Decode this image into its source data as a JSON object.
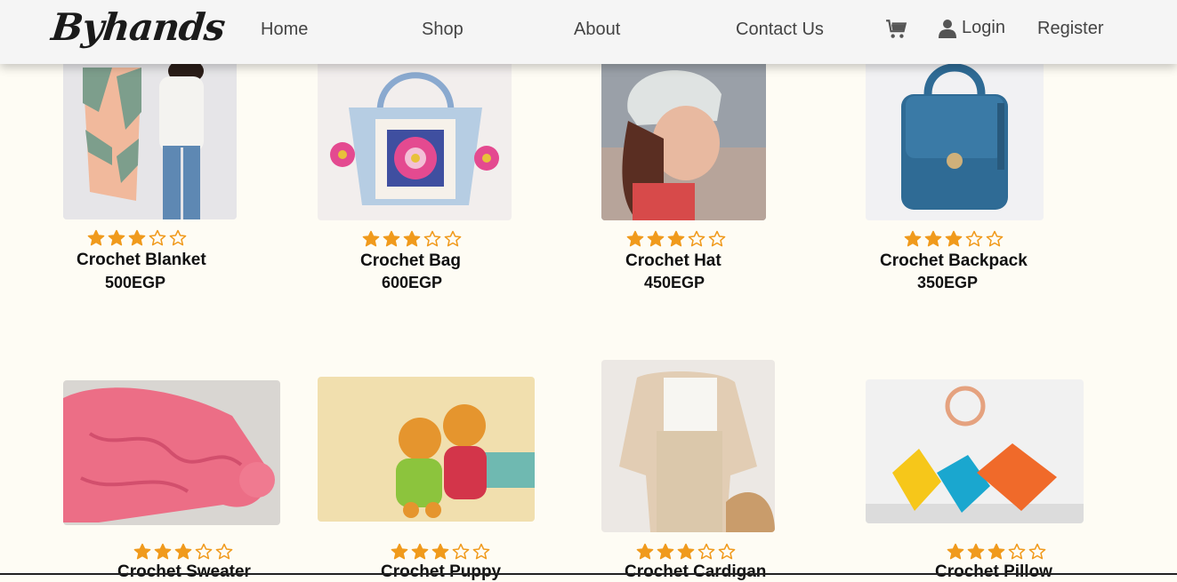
{
  "brand": {
    "logo_text": "Byhands"
  },
  "nav": {
    "links": [
      "Home",
      "Shop",
      "About",
      "Contact Us"
    ],
    "login_label": "Login",
    "register_label": "Register",
    "cart_icon": "cart-icon",
    "user_icon": "user-icon"
  },
  "colors": {
    "star": "#f09a1c",
    "background": "#fefcf4",
    "nav_bg": "#f5f5f5"
  },
  "products": [
    {
      "name": "Crochet Blanket",
      "price": "500EGP",
      "rating": 3,
      "max_rating": 5
    },
    {
      "name": "Crochet Bag",
      "price": "600EGP",
      "rating": 3,
      "max_rating": 5
    },
    {
      "name": "Crochet Hat",
      "price": "450EGP",
      "rating": 3,
      "max_rating": 5
    },
    {
      "name": "Crochet Backpack",
      "price": "350EGP",
      "rating": 3,
      "max_rating": 5
    },
    {
      "name": "Crochet Sweater",
      "rating": 3,
      "max_rating": 5
    },
    {
      "name": "Crochet Puppy",
      "rating": 3,
      "max_rating": 5
    },
    {
      "name": "Crochet Cardigan",
      "rating": 3,
      "max_rating": 5
    },
    {
      "name": "Crochet Pillow",
      "rating": 3,
      "max_rating": 5
    }
  ]
}
